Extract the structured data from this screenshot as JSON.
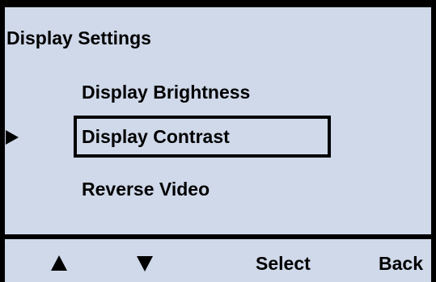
{
  "screen": {
    "title": "Display Settings",
    "items": [
      {
        "label": "Display Brightness",
        "selected": false
      },
      {
        "label": "Display Contrast",
        "selected": true
      },
      {
        "label": "Reverse Video",
        "selected": false
      }
    ],
    "cursor_icon": "right-triangle-pointer"
  },
  "softkeys": {
    "up_icon": "up-triangle",
    "down_icon": "down-triangle",
    "select_label": "Select",
    "back_label": "Back"
  },
  "colors": {
    "background": "#d0d9ea",
    "foreground": "#000000"
  }
}
